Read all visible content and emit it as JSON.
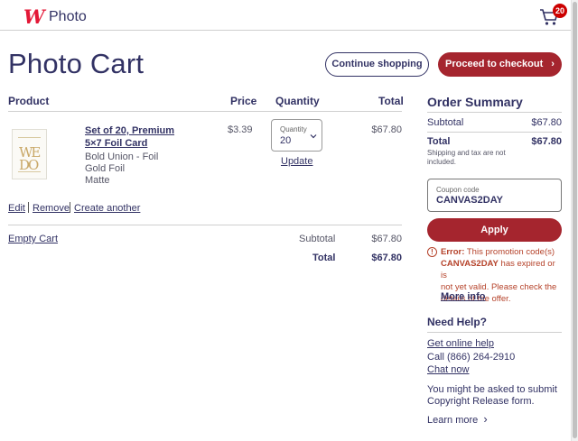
{
  "header": {
    "logo_mark": "W",
    "logo_text": "Photo",
    "cart_count": "20"
  },
  "page_title": "Photo Cart",
  "buttons": {
    "continue_shopping": "Continue shopping",
    "checkout": "Proceed to checkout"
  },
  "table": {
    "headers": {
      "product": "Product",
      "price": "Price",
      "quantity": "Quantity",
      "total": "Total"
    }
  },
  "item": {
    "thumb_text": "WE DO",
    "name": "Set of 20, Premium 5×7 Foil Card",
    "attrs": [
      "Bold Union - Foil",
      "Gold Foil",
      "Matte"
    ],
    "price": "$3.39",
    "quantity_label": "Quantity",
    "quantity": "20",
    "update": "Update",
    "total": "$67.80",
    "actions": {
      "edit": "Edit",
      "remove": "Remove",
      "create_another": "Create another"
    }
  },
  "cart_footer": {
    "empty_cart": "Empty Cart",
    "subtotal_label": "Subtotal",
    "subtotal": "$67.80",
    "total_label": "Total",
    "total": "$67.80"
  },
  "summary": {
    "title": "Order Summary",
    "subtotal_label": "Subtotal",
    "subtotal": "$67.80",
    "total_label": "Total",
    "total": "$67.80",
    "tax_note_1": "Shipping and tax are not",
    "tax_note_2": "included.",
    "coupon_label": "Coupon code",
    "coupon_value": "CANVAS2DAY",
    "apply": "Apply",
    "error_prefix": "Error:",
    "error_text_1": "This promotion code(s)",
    "error_code": "CANVAS2DAY",
    "error_text_2": "has expired or is",
    "error_text_3": "not yet valid. Please check the",
    "error_text_4": "details of the offer.",
    "more_info": "More info"
  },
  "help": {
    "title": "Need Help?",
    "online_help": "Get online help",
    "call": "Call (866) 264-2910",
    "chat": "Chat now",
    "release_1": "You might be asked to submit",
    "release_2": "Copyright Release form.",
    "learn_more": "Learn more"
  },
  "colors": {
    "brand_red": "#e31837",
    "button_red": "#a5252e",
    "text_navy": "#323264",
    "error": "#b5422a"
  }
}
